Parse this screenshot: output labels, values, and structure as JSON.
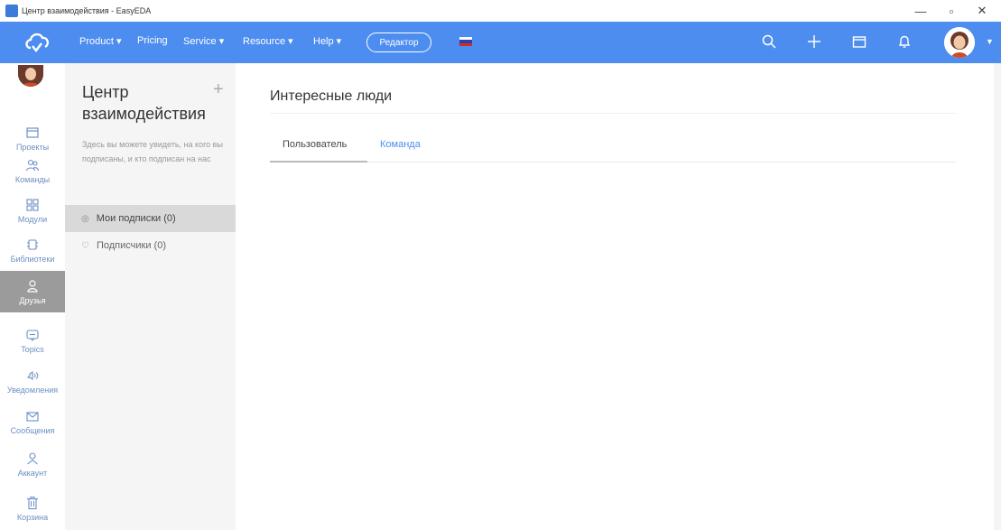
{
  "window": {
    "title": "Центр взаимодействия - EasyEDA"
  },
  "topbar": {
    "nav": [
      {
        "label": "Product ▾"
      },
      {
        "label": "Pricing"
      },
      {
        "label": "Service ▾"
      },
      {
        "label": "Resource ▾"
      },
      {
        "label": "Help ▾"
      }
    ],
    "editor_label": "Редактор",
    "colors": {
      "accent": "#4d8df0"
    }
  },
  "sidebar": {
    "items": [
      {
        "label": "Проекты",
        "icon": "folder-icon"
      },
      {
        "label": "Команды",
        "icon": "team-icon"
      },
      {
        "label": "Модули",
        "icon": "modules-icon"
      },
      {
        "label": "Библиотеки",
        "icon": "chip-icon"
      },
      {
        "label": "Друзья",
        "icon": "friends-icon",
        "active": true
      },
      {
        "label": "Topics",
        "icon": "topics-icon"
      },
      {
        "label": "Уведомления",
        "icon": "bell-icon"
      },
      {
        "label": "Сообщения",
        "icon": "mail-icon"
      },
      {
        "label": "Аккаунт",
        "icon": "user-icon"
      },
      {
        "label": "Корзина",
        "icon": "trash-icon"
      }
    ]
  },
  "panel": {
    "title": "Центр взаимодействия",
    "description": "Здесь вы можете увидеть, на кого вы подписаны, и кто подписан на нас",
    "items": [
      {
        "label": "Мои подписки (0)",
        "icon": "eye-icon"
      },
      {
        "label": "Подписчики (0)",
        "icon": "heart-icon"
      }
    ]
  },
  "main": {
    "title": "Интересные люди",
    "tabs": [
      {
        "label": "Пользователь"
      },
      {
        "label": "Команда"
      }
    ]
  }
}
